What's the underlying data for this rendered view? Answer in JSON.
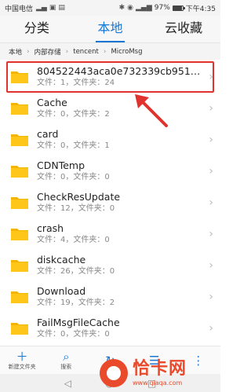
{
  "status_bar": {
    "carrier": "中国电信",
    "battery_percent": "97%",
    "battery_level": 0.97,
    "time": "下午4:35"
  },
  "tabs": [
    {
      "label": "分类"
    },
    {
      "label": "本地"
    },
    {
      "label": "云收藏"
    }
  ],
  "breadcrumb": [
    "本地",
    "内部存储",
    "tencent",
    "MicroMsg"
  ],
  "files": [
    {
      "name": "804522443aca0e732339cb951b...",
      "meta": "文件：1，文件夹：24"
    },
    {
      "name": "Cache",
      "meta": "文件：0，文件夹：2"
    },
    {
      "name": "card",
      "meta": "文件：0，文件夹：1"
    },
    {
      "name": "CDNTemp",
      "meta": "文件：0，文件夹：0"
    },
    {
      "name": "CheckResUpdate",
      "meta": "文件：12，文件夹：0"
    },
    {
      "name": "crash",
      "meta": "文件：4，文件夹：0"
    },
    {
      "name": "diskcache",
      "meta": "文件：26，文件夹：0"
    },
    {
      "name": "Download",
      "meta": "文件：19，文件夹：2"
    },
    {
      "name": "FailMsgFileCache",
      "meta": "文件：0，文件夹：0"
    }
  ],
  "toolbar": [
    {
      "icon": "plus-icon",
      "label": "新建文件夹"
    },
    {
      "icon": "search-icon",
      "label": "搜索"
    },
    {
      "icon": "refresh-icon",
      "label": ""
    },
    {
      "icon": "sort-icon",
      "label": ""
    },
    {
      "icon": "more-icon",
      "label": ""
    }
  ],
  "watermark": {
    "brand": "恰卡网",
    "url": "www.qiaqa.com"
  },
  "colors": {
    "accent": "#1976d2",
    "folder": "#f5b400",
    "highlight": "#e0332e",
    "watermark": "#e94a2b"
  }
}
